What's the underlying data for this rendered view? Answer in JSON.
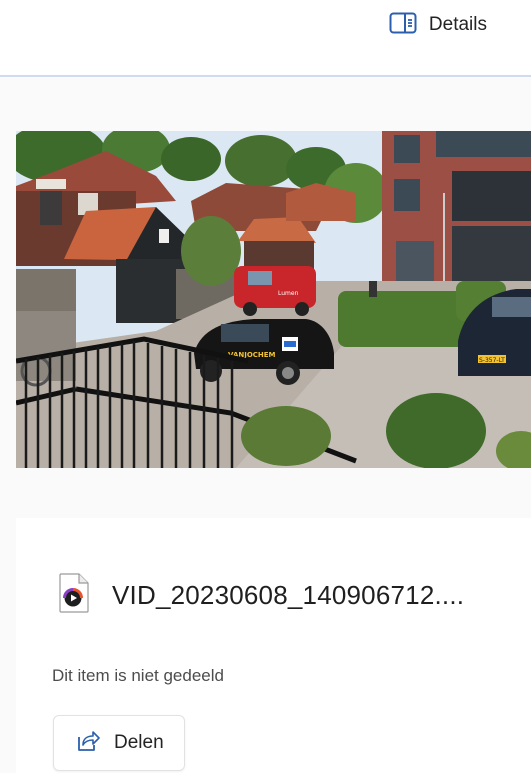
{
  "header": {
    "details_label": "Details"
  },
  "file": {
    "name": "VID_20230608_140906712....",
    "share_status": "Dit item is niet gedeeld",
    "share_label": "Delen"
  },
  "van_text": "Lumen",
  "car_text": "VANJOCHEM",
  "plate_text": "S-357-LT",
  "colors": {
    "divider": "#cfdcef",
    "accent": "#2b5fad"
  }
}
